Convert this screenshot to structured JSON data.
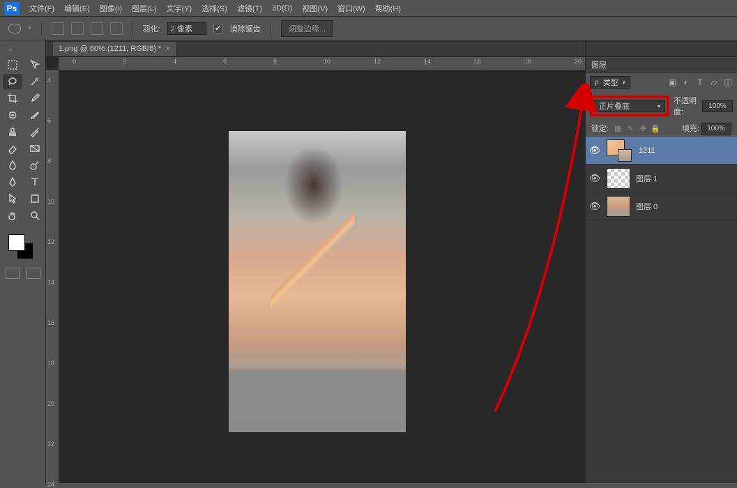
{
  "menu": {
    "items": [
      "文件(F)",
      "编辑(E)",
      "图像(I)",
      "图层(L)",
      "文字(Y)",
      "选择(S)",
      "滤镜(T)",
      "3D(D)",
      "视图(V)",
      "窗口(W)",
      "帮助(H)"
    ]
  },
  "optionsbar": {
    "feather_label": "羽化:",
    "feather_value": "2 像素",
    "antialias_label": "消除锯齿",
    "refine_btn": "调整边缘..."
  },
  "document": {
    "tab_title": "1.png @ 60% (1211, RGB/8) *"
  },
  "ruler_h": [
    "0",
    "2",
    "4",
    "6",
    "8",
    "10",
    "12",
    "14",
    "16",
    "18",
    "20"
  ],
  "ruler_v": [
    "4",
    "6",
    "8",
    "10",
    "12",
    "14",
    "16",
    "18",
    "20",
    "22",
    "24"
  ],
  "panel": {
    "title": "图层",
    "filter_label": "类型",
    "blend_mode": "正片叠底",
    "opacity_label": "不透明度:",
    "opacity_value": "100%",
    "lock_label": "锁定:",
    "fill_label": "填充:",
    "fill_value": "100%",
    "layers": [
      {
        "name": "1211",
        "selected": true,
        "thumb": "stack"
      },
      {
        "name": "图层 1",
        "selected": false,
        "thumb": "chk"
      },
      {
        "name": "图层 0",
        "selected": false,
        "thumb": "img"
      }
    ]
  },
  "colors": {
    "fg": "#ffffff",
    "bg": "#000000",
    "highlight": "#d40000"
  }
}
